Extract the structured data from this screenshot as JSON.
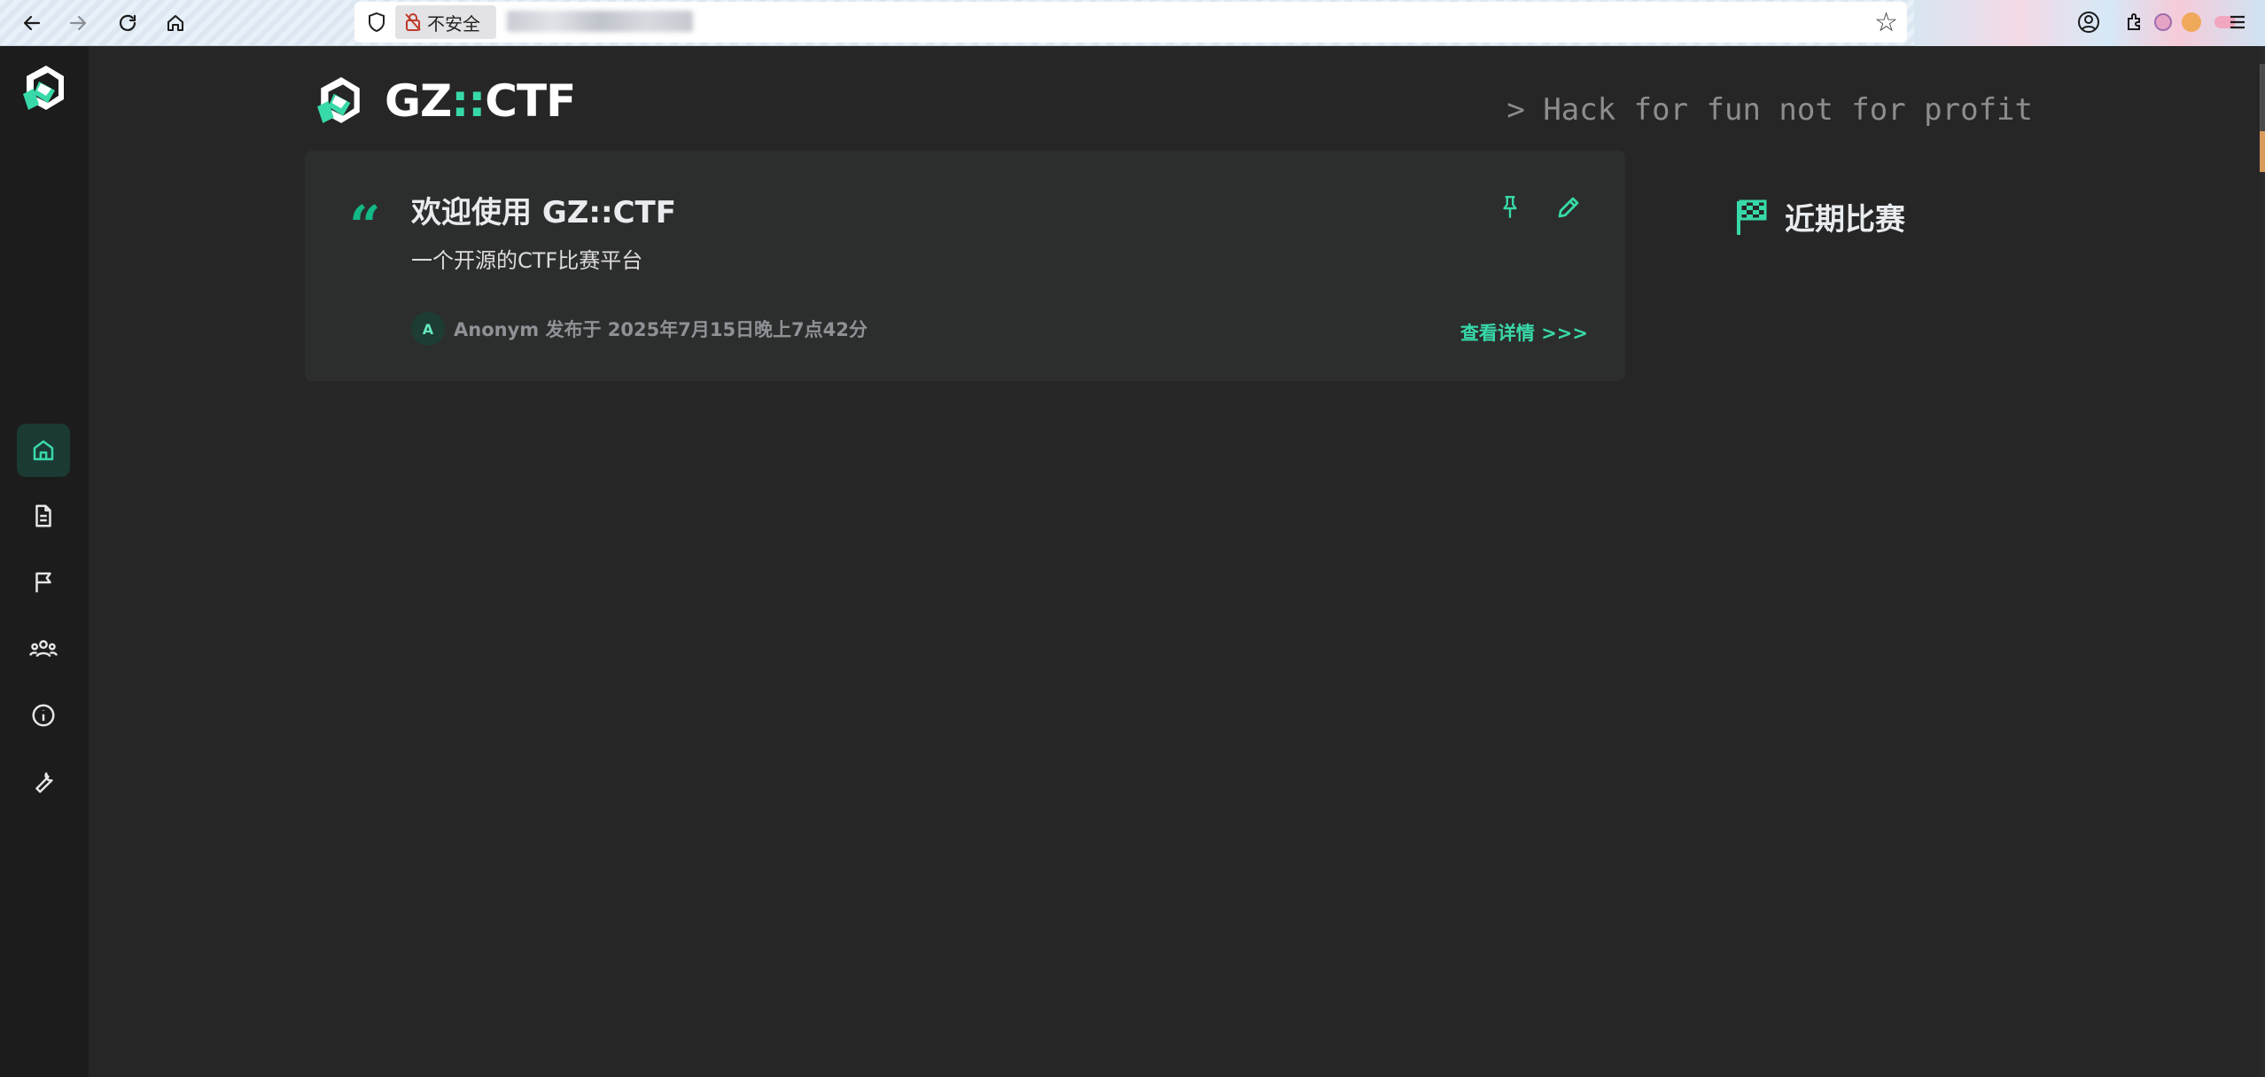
{
  "browser": {
    "security_label": "不安全",
    "back_icon": "arrow-left-icon",
    "forward_icon": "arrow-right-icon",
    "reload_icon": "reload-icon",
    "home_icon": "home-icon"
  },
  "header": {
    "brand_prefix": "GZ",
    "brand_separator": "::",
    "brand_suffix": "CTF",
    "slogan": "> Hack for fun not for profit"
  },
  "sidebar": {
    "items": [
      {
        "icon": "home-icon",
        "active": true
      },
      {
        "icon": "document-icon",
        "active": false
      },
      {
        "icon": "flag-icon",
        "active": false
      },
      {
        "icon": "users-icon",
        "active": false
      },
      {
        "icon": "info-icon",
        "active": false
      },
      {
        "icon": "wrench-icon",
        "active": false
      }
    ]
  },
  "notice": {
    "title": "欢迎使用 GZ::CTF",
    "body": "一个开源的CTF比赛平台",
    "avatar_letter": "A",
    "meta": "Anonym 发布于 2025年7月15日晚上7点42分",
    "detail_link": "查看详情 >>>"
  },
  "recent": {
    "title": "近期比赛"
  },
  "colors": {
    "accent": "#38d9a9",
    "accent_dark": "#12b886",
    "background": "#262626",
    "sidebar": "#1c1c1c",
    "card": "#2c2e2d"
  }
}
